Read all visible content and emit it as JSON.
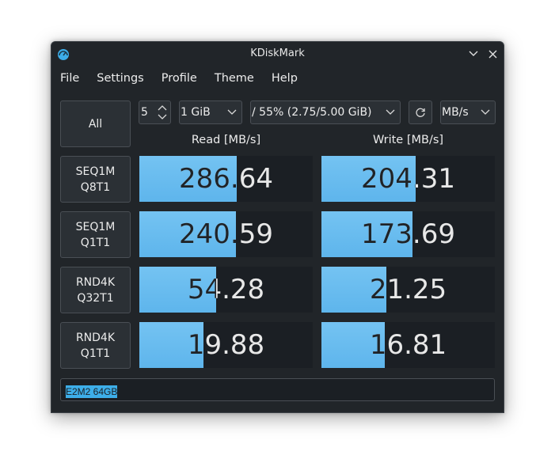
{
  "window": {
    "title": "KDiskMark"
  },
  "menu": [
    "File",
    "Settings",
    "Profile",
    "Theme",
    "Help"
  ],
  "controls": {
    "all_button": "All",
    "loops": "5",
    "size": "1 GiB",
    "drive": "/ 55% (2.75/5.00 GiB)",
    "unit": "MB/s"
  },
  "headers": {
    "read": "Read [MB/s]",
    "write": "Write [MB/s]"
  },
  "tests": [
    {
      "line1": "SEQ1M",
      "line2": "Q8T1",
      "read": "286.64",
      "write": "204.31",
      "read_fill": 0.56,
      "write_fill": 0.545
    },
    {
      "line1": "SEQ1M",
      "line2": "Q1T1",
      "read": "240.59",
      "write": "173.69",
      "read_fill": 0.555,
      "write_fill": 0.525
    },
    {
      "line1": "RND4K",
      "line2": "Q32T1",
      "read": "54.28",
      "write": "21.25",
      "read_fill": 0.445,
      "write_fill": 0.375
    },
    {
      "line1": "RND4K",
      "line2": "Q1T1",
      "read": "19.88",
      "write": "16.81",
      "read_fill": 0.37,
      "write_fill": 0.365
    }
  ],
  "comment": "E2M2 64GB",
  "colors": {
    "background": "#212529",
    "bar": "#5eb5ec",
    "selection": "#3daee9"
  }
}
